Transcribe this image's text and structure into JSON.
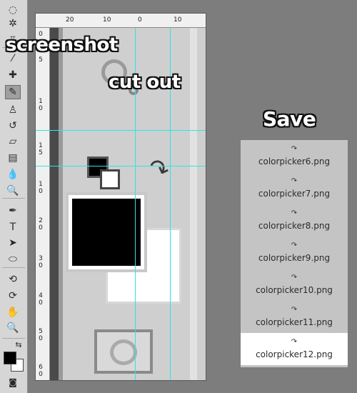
{
  "captions": {
    "screenshot": "screenshot",
    "cut_out": "cut out",
    "save": "Save"
  },
  "ruler": {
    "horizontal_labels": [
      "20",
      "10",
      "0",
      "10"
    ],
    "vertical_labels": [
      "0",
      "5",
      "1\n0",
      "1\n5",
      "0",
      "1\n0",
      "2\n0",
      "3\n0",
      "4\n0",
      "5\n0",
      "6\n0"
    ]
  },
  "toolbar": {
    "tools": [
      {
        "name": "lasso-tool-icon",
        "glyph": "◌"
      },
      {
        "name": "magic-wand-tool-icon",
        "glyph": "✲"
      },
      {
        "name": "crop-tool-icon",
        "glyph": "⌗"
      },
      {
        "name": "eyedropper-tool-icon",
        "glyph": "⁄"
      },
      {
        "name": "spot-healing-tool-icon",
        "glyph": "✚"
      },
      {
        "name": "brush-tool-icon",
        "glyph": "✎"
      },
      {
        "name": "clone-stamp-tool-icon",
        "glyph": "♙"
      },
      {
        "name": "history-brush-tool-icon",
        "glyph": "↺"
      },
      {
        "name": "eraser-tool-icon",
        "glyph": "▱"
      },
      {
        "name": "gradient-tool-icon",
        "glyph": "▤"
      },
      {
        "name": "blur-tool-icon",
        "glyph": "💧"
      },
      {
        "name": "dodge-tool-icon",
        "glyph": "🔍"
      },
      {
        "name": "pen-tool-icon",
        "glyph": "✒"
      },
      {
        "name": "type-tool-icon",
        "glyph": "T"
      },
      {
        "name": "path-selection-tool-icon",
        "glyph": "➤"
      },
      {
        "name": "ellipse-tool-icon",
        "glyph": "⬭"
      },
      {
        "name": "3d-rotate-tool-icon",
        "glyph": "⟲"
      },
      {
        "name": "3d-orbit-tool-icon",
        "glyph": "⟳"
      },
      {
        "name": "hand-tool-icon",
        "glyph": "✋"
      },
      {
        "name": "zoom-tool-icon",
        "glyph": "🔍"
      }
    ],
    "foreground_color": "#000000",
    "background_color": "#ffffff"
  },
  "files": [
    {
      "name": "colorpicker6.png",
      "selected": false
    },
    {
      "name": "colorpicker7.png",
      "selected": false
    },
    {
      "name": "colorpicker8.png",
      "selected": false
    },
    {
      "name": "colorpicker9.png",
      "selected": false
    },
    {
      "name": "colorpicker10.png",
      "selected": false
    },
    {
      "name": "colorpicker11.png",
      "selected": false
    },
    {
      "name": "colorpicker12.png",
      "selected": true
    }
  ],
  "colors": {
    "guide": "#30e3e3",
    "panel_bg": "#c4c4c4",
    "selected_row": "#ffffff"
  }
}
